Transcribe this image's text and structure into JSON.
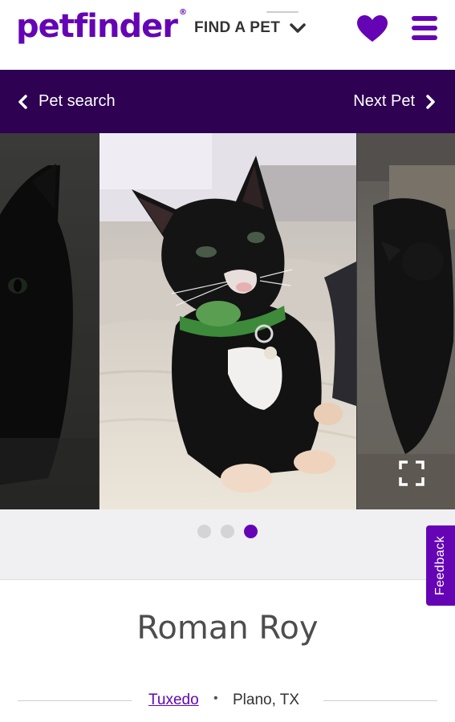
{
  "header": {
    "logo_text": "petfinder",
    "nav_label": "FIND A PET",
    "favorites_icon": "heart-icon",
    "menu_icon": "hamburger-menu-icon"
  },
  "navbar": {
    "prev_label": "Pet search",
    "next_label": "Next Pet"
  },
  "carousel": {
    "total_slides": 3,
    "active_slide": 3,
    "expand_icon": "expand-fullscreen-icon"
  },
  "feedback": {
    "label": "Feedback"
  },
  "pet": {
    "name": "Roman Roy",
    "breed": "Tuxedo",
    "separator": "•",
    "location": "Plano, TX"
  },
  "colors": {
    "brand_purple": "#6504b5",
    "nav_bg": "#2e0152"
  }
}
